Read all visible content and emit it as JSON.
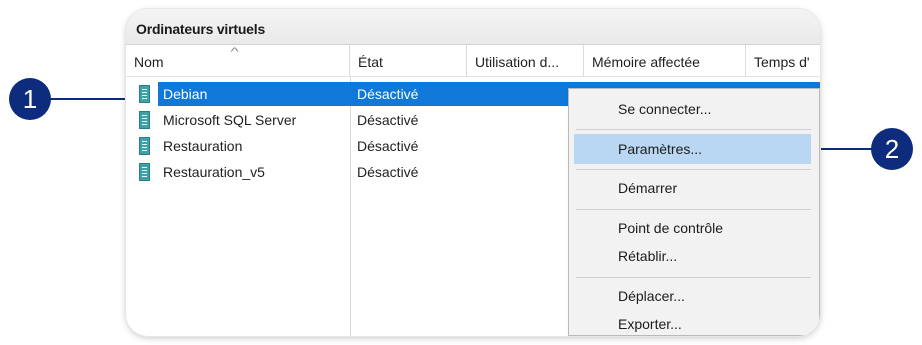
{
  "panel": {
    "title": "Ordinateurs virtuels"
  },
  "columns": [
    {
      "label": "Nom"
    },
    {
      "label": "État"
    },
    {
      "label": "Utilisation d..."
    },
    {
      "label": "Mémoire affectée"
    },
    {
      "label": "Temps d'"
    }
  ],
  "icons": {
    "sort": "sort-up-icon",
    "vm": "virtual-machine-icon"
  },
  "rows": [
    {
      "name": "Debian",
      "state": "Désactivé",
      "selected": true
    },
    {
      "name": "Microsoft SQL Server",
      "state": "Désactivé",
      "selected": false
    },
    {
      "name": "Restauration",
      "state": "Désactivé",
      "selected": false
    },
    {
      "name": "Restauration_v5",
      "state": "Désactivé",
      "selected": false
    }
  ],
  "context_menu": {
    "items": [
      {
        "label": "Se connecter..."
      },
      {
        "label": "Paramètres...",
        "highlighted": true
      },
      {
        "label": "Démarrer"
      },
      {
        "label": "Point de contrôle"
      },
      {
        "label": "Rétablir..."
      },
      {
        "label": "Déplacer..."
      },
      {
        "label": "Exporter..."
      }
    ]
  },
  "callouts": [
    {
      "label": "1"
    },
    {
      "label": "2"
    }
  ],
  "colors": {
    "selection": "#0f78d8",
    "menu_highlight": "#b9d6f3",
    "callout": "#0e2c7e",
    "vm_icon": "#3da1a8"
  }
}
